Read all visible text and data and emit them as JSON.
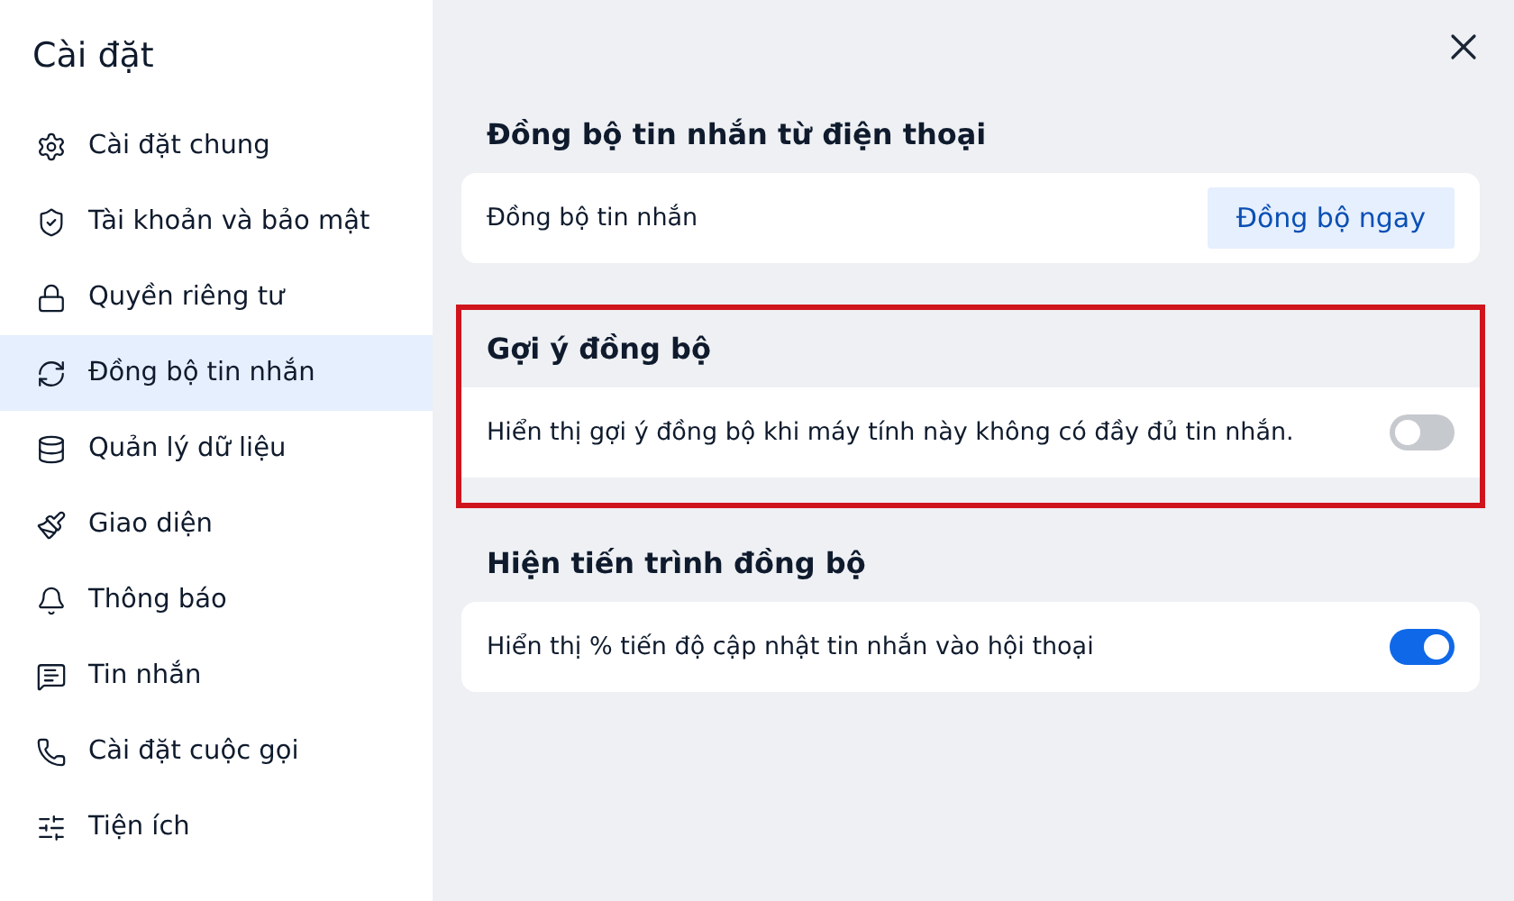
{
  "sidebar": {
    "title": "Cài đặt",
    "items": [
      {
        "label": "Cài đặt chung",
        "selected": false
      },
      {
        "label": "Tài khoản và bảo mật",
        "selected": false
      },
      {
        "label": "Quyền riêng tư",
        "selected": false
      },
      {
        "label": "Đồng bộ tin nhắn",
        "selected": true
      },
      {
        "label": "Quản lý dữ liệu",
        "selected": false
      },
      {
        "label": "Giao diện",
        "selected": false
      },
      {
        "label": "Thông báo",
        "selected": false
      },
      {
        "label": "Tin nhắn",
        "selected": false
      },
      {
        "label": "Cài đặt cuộc gọi",
        "selected": false
      },
      {
        "label": "Tiện ích",
        "selected": false
      }
    ]
  },
  "sections": [
    {
      "title": "Đồng bộ tin nhắn từ điện thoại",
      "highlighted": false,
      "row": {
        "kind": "button",
        "label": "Đồng bộ tin nhắn",
        "button": "Đồng bộ ngay"
      }
    },
    {
      "title": "Gợi ý đồng bộ",
      "highlighted": true,
      "row": {
        "kind": "toggle",
        "label": "Hiển thị gợi ý đồng bộ khi máy tính này không có đầy đủ tin nhắn.",
        "on": false
      }
    },
    {
      "title": "Hiện tiến trình đồng bộ",
      "highlighted": false,
      "row": {
        "kind": "toggle",
        "label": "Hiển thị % tiến độ cập nhật tin nhắn vào hội thoại",
        "on": true
      }
    }
  ]
}
